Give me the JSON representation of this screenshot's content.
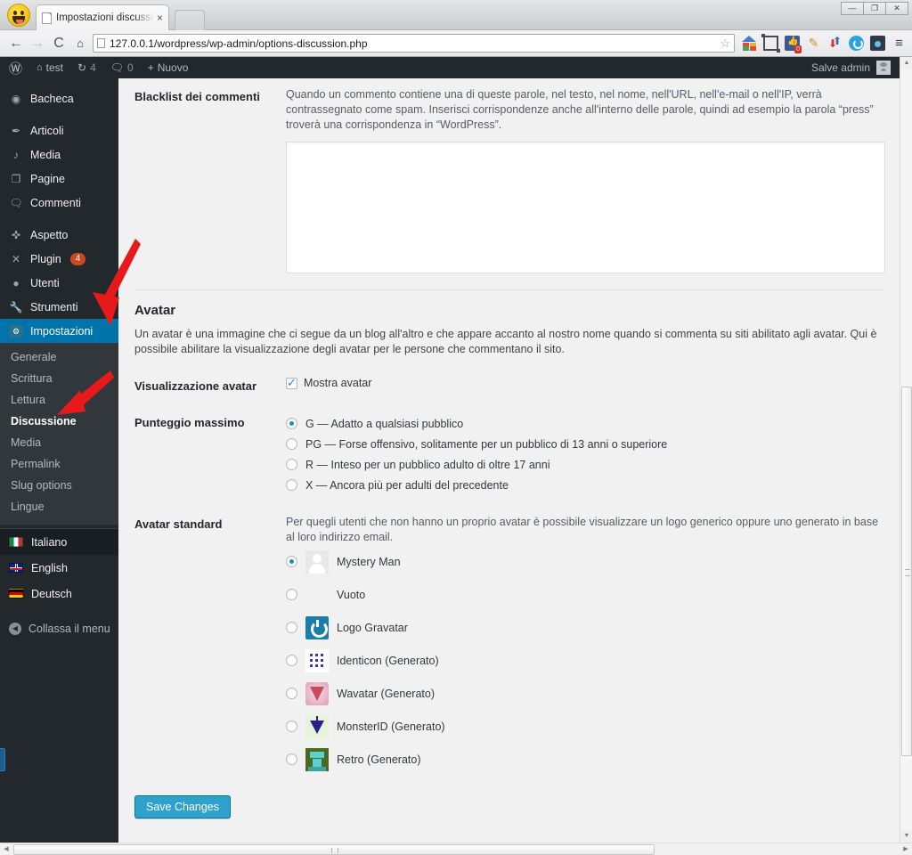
{
  "browser": {
    "tab_title": "Impostazioni discussione",
    "tab_close": "×",
    "back_icon": "←",
    "forward_icon": "→",
    "reload_icon": "C",
    "home_icon": "⌂",
    "url": "127.0.0.1/wordpress/wp-admin/options-discussion.php",
    "bookmark_star": "☆",
    "window_minimize": "—",
    "window_maximize": "❐",
    "window_close": "✕",
    "extensions": [
      "home-colored-icon",
      "frame-capture-icon",
      "facebook-icon",
      "pencil-icon",
      "updown-arrows-icon",
      "refresh-circle-icon",
      "camera-icon",
      "chrome-menu-icon"
    ],
    "facebook_badge": "0"
  },
  "adminbar": {
    "wp_logo": "Ⓦ",
    "site_name": "test",
    "updates_icon": "↻",
    "updates_count": "4",
    "comments_icon": "🗨",
    "comments_count": "0",
    "new_plus": "+",
    "new_label": "Nuovo",
    "greeting": "Salve admin"
  },
  "sidebar": {
    "items": [
      {
        "label": "Bacheca",
        "icon": "dashboard-icon",
        "glyph": "◉"
      },
      {
        "label": "Articoli",
        "icon": "pin-icon",
        "glyph": "✒"
      },
      {
        "label": "Media",
        "icon": "media-icon",
        "glyph": "♫"
      },
      {
        "label": "Pagine",
        "icon": "page-icon",
        "glyph": "❒"
      },
      {
        "label": "Commenti",
        "icon": "comment-icon",
        "glyph": "🗨"
      },
      {
        "label": "Aspetto",
        "icon": "brush-icon",
        "glyph": "✎"
      },
      {
        "label": "Plugin",
        "icon": "plug-icon",
        "glyph": "⚡",
        "badge": "4"
      },
      {
        "label": "Utenti",
        "icon": "user-icon",
        "glyph": "👤"
      },
      {
        "label": "Strumenti",
        "icon": "wrench-icon",
        "glyph": "🔧"
      },
      {
        "label": "Impostazioni",
        "icon": "settings-icon",
        "glyph": "⚙",
        "current": true
      }
    ],
    "submenu": [
      {
        "label": "Generale"
      },
      {
        "label": "Scrittura"
      },
      {
        "label": "Lettura"
      },
      {
        "label": "Discussione",
        "current": true
      },
      {
        "label": "Media"
      },
      {
        "label": "Permalink"
      },
      {
        "label": "Slug options"
      },
      {
        "label": "Lingue"
      }
    ],
    "languages": [
      {
        "label": "Italiano",
        "flag": "flag-it",
        "active": true
      },
      {
        "label": "English",
        "flag": "flag-uk"
      },
      {
        "label": "Deutsch",
        "flag": "flag-de"
      }
    ],
    "collapse_label": "Collassa il menu",
    "collapse_icon": "◀",
    "accent_color": "#0073aa",
    "background_color": "#23282d"
  },
  "main": {
    "blacklist": {
      "label": "Blacklist dei commenti",
      "description": "Quando un commento contiene una di queste parole, nel testo, nel nome, nell'URL, nell'e-mail o nell'IP, verrà contrassegnato come spam. Inserisci corrispondenze anche all'interno delle parole, quindi ad esempio la parola “press” troverà una corrispondenza in “WordPress”.",
      "value": ""
    },
    "avatar_section": {
      "heading": "Avatar",
      "description": "Un avatar è una immagine che ci segue da un blog all'altro e che appare accanto al nostro nome quando si commenta su siti abilitato agli avatar. Qui è possibile abilitare la visualizzazione degli avatar per le persone che commentano il sito."
    },
    "avatar_display": {
      "label": "Visualizzazione avatar",
      "checkbox_label": "Mostra avatar",
      "checked": true
    },
    "max_rating": {
      "label": "Punteggio massimo",
      "options": [
        {
          "label": "G — Adatto a qualsiasi pubblico",
          "selected": true
        },
        {
          "label": "PG — Forse offensivo, solitamente per un pubblico di 13 anni o superiore",
          "selected": false
        },
        {
          "label": "R — Inteso per un pubblico adulto di oltre 17 anni",
          "selected": false
        },
        {
          "label": "X — Ancora più per adulti del precedente",
          "selected": false
        }
      ]
    },
    "default_avatar": {
      "label": "Avatar standard",
      "description": "Per quegli utenti che non hanno un proprio avatar è possibile visualizzare un logo generico oppure uno generato in base al loro indirizzo email.",
      "options": [
        {
          "label": "Mystery Man",
          "thumb": "av-mystery",
          "selected": true
        },
        {
          "label": "Vuoto",
          "thumb": "av-blank",
          "selected": false
        },
        {
          "label": "Logo Gravatar",
          "thumb": "av-grav",
          "selected": false
        },
        {
          "label": "Identicon (Generato)",
          "thumb": "av-ident",
          "selected": false
        },
        {
          "label": "Wavatar (Generato)",
          "thumb": "av-wav",
          "selected": false
        },
        {
          "label": "MonsterID (Generato)",
          "thumb": "av-mon",
          "selected": false
        },
        {
          "label": "Retro (Generato)",
          "thumb": "av-retro",
          "selected": false
        }
      ]
    },
    "save_button": "Save Changes",
    "button_color": "#2ea2cc"
  },
  "annotations": {
    "arrow_color": "#e8191b",
    "arrows": [
      {
        "name": "arrow-pointing-to-impostazioni"
      },
      {
        "name": "arrow-pointing-to-discussione"
      }
    ]
  },
  "scrollbars": {
    "vertical_up": "▲",
    "vertical_down": "▼",
    "horizontal_left": "◀",
    "horizontal_right": "▶"
  }
}
